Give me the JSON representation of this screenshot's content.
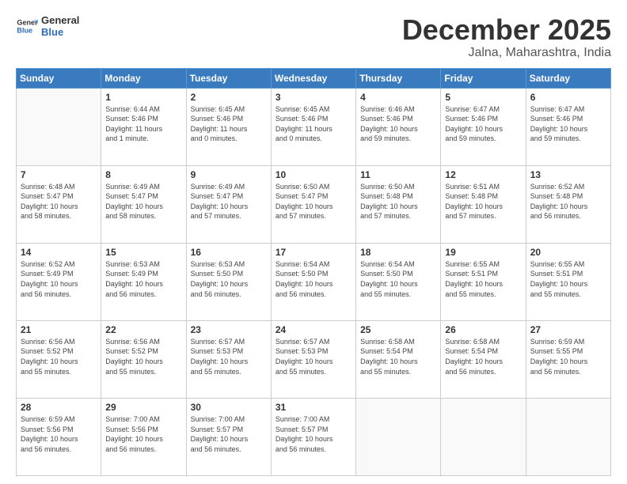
{
  "header": {
    "logo_line1": "General",
    "logo_line2": "Blue",
    "month": "December 2025",
    "location": "Jalna, Maharashtra, India"
  },
  "weekdays": [
    "Sunday",
    "Monday",
    "Tuesday",
    "Wednesday",
    "Thursday",
    "Friday",
    "Saturday"
  ],
  "weeks": [
    [
      {
        "day": "",
        "info": ""
      },
      {
        "day": "1",
        "info": "Sunrise: 6:44 AM\nSunset: 5:46 PM\nDaylight: 11 hours\nand 1 minute."
      },
      {
        "day": "2",
        "info": "Sunrise: 6:45 AM\nSunset: 5:46 PM\nDaylight: 11 hours\nand 0 minutes."
      },
      {
        "day": "3",
        "info": "Sunrise: 6:45 AM\nSunset: 5:46 PM\nDaylight: 11 hours\nand 0 minutes."
      },
      {
        "day": "4",
        "info": "Sunrise: 6:46 AM\nSunset: 5:46 PM\nDaylight: 10 hours\nand 59 minutes."
      },
      {
        "day": "5",
        "info": "Sunrise: 6:47 AM\nSunset: 5:46 PM\nDaylight: 10 hours\nand 59 minutes."
      },
      {
        "day": "6",
        "info": "Sunrise: 6:47 AM\nSunset: 5:46 PM\nDaylight: 10 hours\nand 59 minutes."
      }
    ],
    [
      {
        "day": "7",
        "info": "Sunrise: 6:48 AM\nSunset: 5:47 PM\nDaylight: 10 hours\nand 58 minutes."
      },
      {
        "day": "8",
        "info": "Sunrise: 6:49 AM\nSunset: 5:47 PM\nDaylight: 10 hours\nand 58 minutes."
      },
      {
        "day": "9",
        "info": "Sunrise: 6:49 AM\nSunset: 5:47 PM\nDaylight: 10 hours\nand 57 minutes."
      },
      {
        "day": "10",
        "info": "Sunrise: 6:50 AM\nSunset: 5:47 PM\nDaylight: 10 hours\nand 57 minutes."
      },
      {
        "day": "11",
        "info": "Sunrise: 6:50 AM\nSunset: 5:48 PM\nDaylight: 10 hours\nand 57 minutes."
      },
      {
        "day": "12",
        "info": "Sunrise: 6:51 AM\nSunset: 5:48 PM\nDaylight: 10 hours\nand 57 minutes."
      },
      {
        "day": "13",
        "info": "Sunrise: 6:52 AM\nSunset: 5:48 PM\nDaylight: 10 hours\nand 56 minutes."
      }
    ],
    [
      {
        "day": "14",
        "info": "Sunrise: 6:52 AM\nSunset: 5:49 PM\nDaylight: 10 hours\nand 56 minutes."
      },
      {
        "day": "15",
        "info": "Sunrise: 6:53 AM\nSunset: 5:49 PM\nDaylight: 10 hours\nand 56 minutes."
      },
      {
        "day": "16",
        "info": "Sunrise: 6:53 AM\nSunset: 5:50 PM\nDaylight: 10 hours\nand 56 minutes."
      },
      {
        "day": "17",
        "info": "Sunrise: 6:54 AM\nSunset: 5:50 PM\nDaylight: 10 hours\nand 56 minutes."
      },
      {
        "day": "18",
        "info": "Sunrise: 6:54 AM\nSunset: 5:50 PM\nDaylight: 10 hours\nand 55 minutes."
      },
      {
        "day": "19",
        "info": "Sunrise: 6:55 AM\nSunset: 5:51 PM\nDaylight: 10 hours\nand 55 minutes."
      },
      {
        "day": "20",
        "info": "Sunrise: 6:55 AM\nSunset: 5:51 PM\nDaylight: 10 hours\nand 55 minutes."
      }
    ],
    [
      {
        "day": "21",
        "info": "Sunrise: 6:56 AM\nSunset: 5:52 PM\nDaylight: 10 hours\nand 55 minutes."
      },
      {
        "day": "22",
        "info": "Sunrise: 6:56 AM\nSunset: 5:52 PM\nDaylight: 10 hours\nand 55 minutes."
      },
      {
        "day": "23",
        "info": "Sunrise: 6:57 AM\nSunset: 5:53 PM\nDaylight: 10 hours\nand 55 minutes."
      },
      {
        "day": "24",
        "info": "Sunrise: 6:57 AM\nSunset: 5:53 PM\nDaylight: 10 hours\nand 55 minutes."
      },
      {
        "day": "25",
        "info": "Sunrise: 6:58 AM\nSunset: 5:54 PM\nDaylight: 10 hours\nand 55 minutes."
      },
      {
        "day": "26",
        "info": "Sunrise: 6:58 AM\nSunset: 5:54 PM\nDaylight: 10 hours\nand 56 minutes."
      },
      {
        "day": "27",
        "info": "Sunrise: 6:59 AM\nSunset: 5:55 PM\nDaylight: 10 hours\nand 56 minutes."
      }
    ],
    [
      {
        "day": "28",
        "info": "Sunrise: 6:59 AM\nSunset: 5:56 PM\nDaylight: 10 hours\nand 56 minutes."
      },
      {
        "day": "29",
        "info": "Sunrise: 7:00 AM\nSunset: 5:56 PM\nDaylight: 10 hours\nand 56 minutes."
      },
      {
        "day": "30",
        "info": "Sunrise: 7:00 AM\nSunset: 5:57 PM\nDaylight: 10 hours\nand 56 minutes."
      },
      {
        "day": "31",
        "info": "Sunrise: 7:00 AM\nSunset: 5:57 PM\nDaylight: 10 hours\nand 56 minutes."
      },
      {
        "day": "",
        "info": ""
      },
      {
        "day": "",
        "info": ""
      },
      {
        "day": "",
        "info": ""
      }
    ]
  ]
}
